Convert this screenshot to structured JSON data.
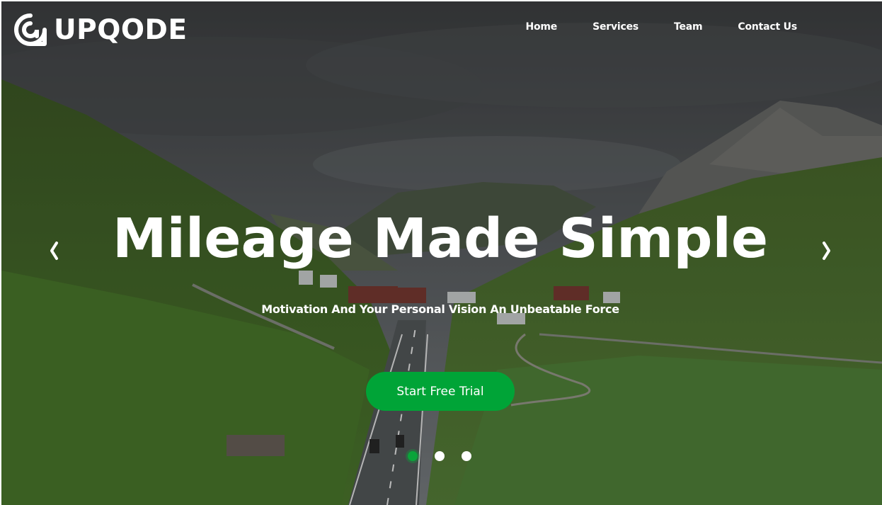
{
  "brand": {
    "name": "UPQODE",
    "logo_icon": "upqode-q-icon"
  },
  "nav": {
    "items": [
      {
        "label": "Home"
      },
      {
        "label": "Services"
      },
      {
        "label": "Team"
      },
      {
        "label": "Contact Us"
      }
    ]
  },
  "hero": {
    "title": "Mileage Made Simple",
    "subtitle": "Motivation And Your Personal Vision An Unbeatable Force",
    "cta_label": "Start Free Trial",
    "prev_icon": "chevron-left-icon",
    "next_icon": "chevron-right-icon"
  },
  "slider": {
    "count": 3,
    "active_index": 0
  },
  "colors": {
    "accent": "#00a437",
    "text": "#ffffff"
  }
}
